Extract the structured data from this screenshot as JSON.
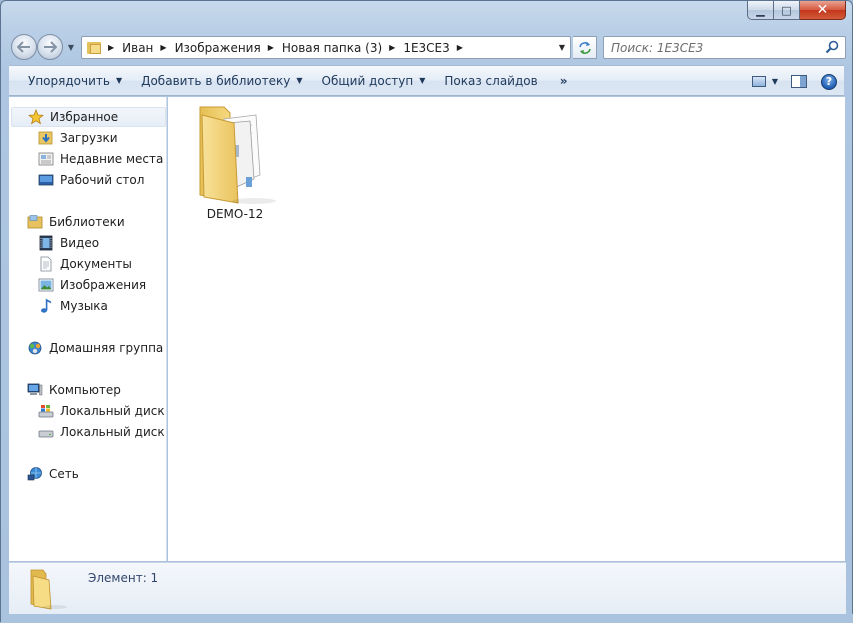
{
  "window": {
    "caption": {
      "minimize_glyph": "▁",
      "maximize_glyph": "□",
      "close_glyph": "✕"
    }
  },
  "navigation": {
    "breadcrumbs": [
      "Иван",
      "Изображения",
      "Новая папка (3)",
      "1E3CE3"
    ],
    "search_placeholder": "Поиск: 1E3CE3"
  },
  "toolbar": {
    "organize": "Упорядочить",
    "add_to_library": "Добавить в библиотеку",
    "share": "Общий доступ",
    "slideshow": "Показ слайдов",
    "more": "»",
    "help": "?"
  },
  "sidebar": {
    "favorites": {
      "label": "Избранное",
      "items": [
        "Загрузки",
        "Недавние места",
        "Рабочий стол"
      ]
    },
    "libraries": {
      "label": "Библиотеки",
      "items": [
        "Видео",
        "Документы",
        "Изображения",
        "Музыка"
      ]
    },
    "homegroup": {
      "label": "Домашняя группа"
    },
    "computer": {
      "label": "Компьютер",
      "items": [
        "Локальный диск (C",
        "Локальный диск (D"
      ]
    },
    "network": {
      "label": "Сеть"
    }
  },
  "content": {
    "items": [
      {
        "name": "DEMO-12",
        "type": "folder"
      }
    ]
  },
  "details": {
    "status": "Элемент: 1"
  },
  "colors": {
    "folder": "#f3d676",
    "folder_dark": "#d9ae3e",
    "accent": "#1e395b",
    "selection": "#e5edf6"
  }
}
